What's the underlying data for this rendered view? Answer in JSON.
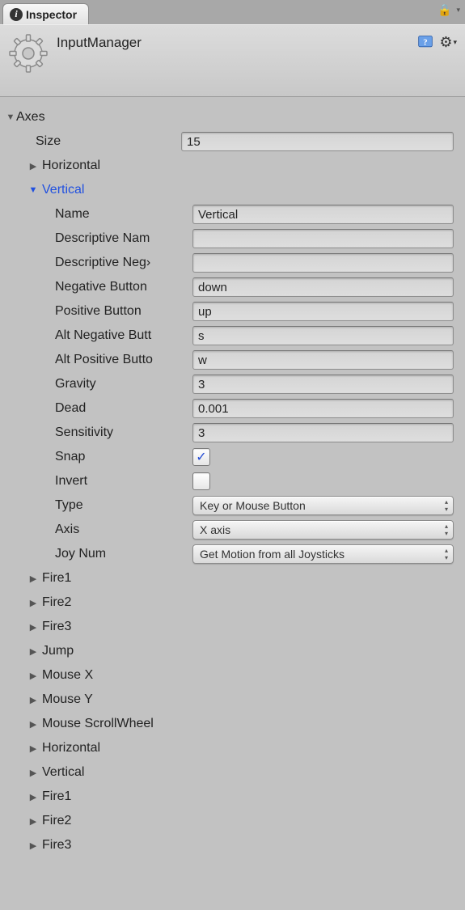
{
  "tab": {
    "title": "Inspector"
  },
  "header": {
    "title": "InputManager"
  },
  "axes": {
    "label": "Axes",
    "size_label": "Size",
    "size_value": "15",
    "items_before": [
      "Horizontal"
    ],
    "expanded": {
      "title": "Vertical",
      "fields": {
        "name_label": "Name",
        "name_value": "Vertical",
        "desc_name_label": "Descriptive Name",
        "desc_name_value": "",
        "desc_neg_label": "Descriptive Negative Name",
        "desc_neg_value": "",
        "neg_btn_label": "Negative Button",
        "neg_btn_value": "down",
        "pos_btn_label": "Positive Button",
        "pos_btn_value": "up",
        "alt_neg_label": "Alt Negative Button",
        "alt_neg_value": "s",
        "alt_pos_label": "Alt Positive Button",
        "alt_pos_value": "w",
        "gravity_label": "Gravity",
        "gravity_value": "3",
        "dead_label": "Dead",
        "dead_value": "0.001",
        "sensitivity_label": "Sensitivity",
        "sensitivity_value": "3",
        "snap_label": "Snap",
        "snap_checked": true,
        "invert_label": "Invert",
        "invert_checked": false,
        "type_label": "Type",
        "type_value": "Key or Mouse Button",
        "axis_label": "Axis",
        "axis_value": "X axis",
        "joynum_label": "Joy Num",
        "joynum_value": "Get Motion from all Joysticks"
      }
    },
    "items_after": [
      "Fire1",
      "Fire2",
      "Fire3",
      "Jump",
      "Mouse X",
      "Mouse Y",
      "Mouse ScrollWheel",
      "Horizontal",
      "Vertical",
      "Fire1",
      "Fire2",
      "Fire3"
    ]
  }
}
